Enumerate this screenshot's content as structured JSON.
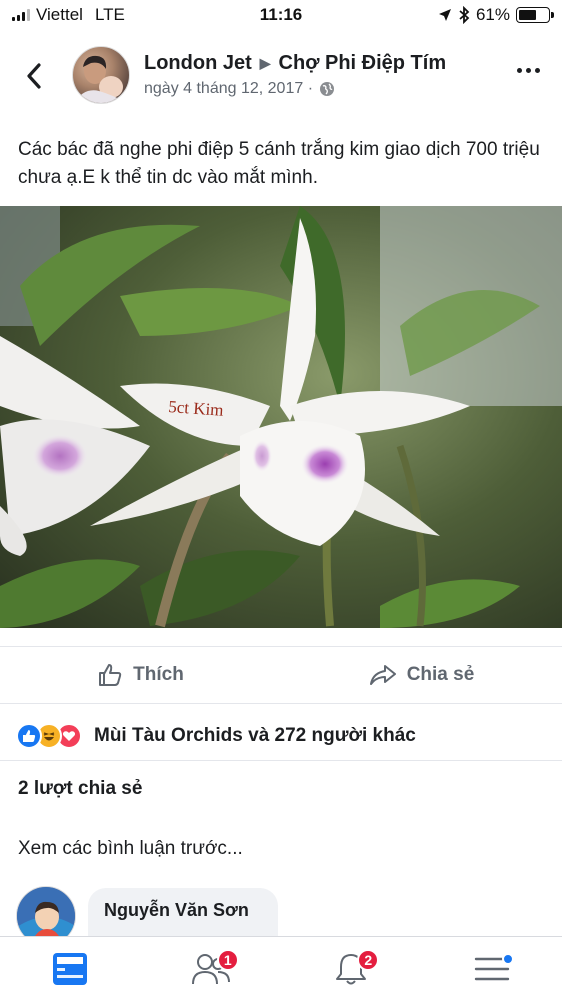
{
  "status_bar": {
    "carrier": "Viettel",
    "network": "LTE",
    "time": "11:16",
    "battery_percent": "61%",
    "battery_level": 0.61
  },
  "post": {
    "author": "London Jet",
    "group": "Chợ Phi Điệp Tím",
    "date": "ngày 4 tháng 12, 2017 ·",
    "text": "Các bác đã nghe phi điệp 5 cánh trắng kim giao dịch 700 triệu chưa ạ.E k thể tin dc vào mắt mình.",
    "photo_caption": "5ct Kim"
  },
  "actions": {
    "like_label": "Thích",
    "share_label": "Chia sẻ"
  },
  "reactions": {
    "summary": "Mùi Tàu Orchids và 272 người khác"
  },
  "shares": {
    "label": "2 lượt chia sẻ"
  },
  "comments": {
    "view_previous": "Xem các bình luận trước...",
    "items": [
      {
        "name": "Nguyễn Văn Sơn"
      }
    ]
  },
  "bottom_nav": {
    "friends_badge": "1",
    "notifications_badge": "2"
  },
  "colors": {
    "accent": "#1877f2",
    "badge": "#e41e3f",
    "love": "#f33e58",
    "haha": "#f7b125"
  }
}
